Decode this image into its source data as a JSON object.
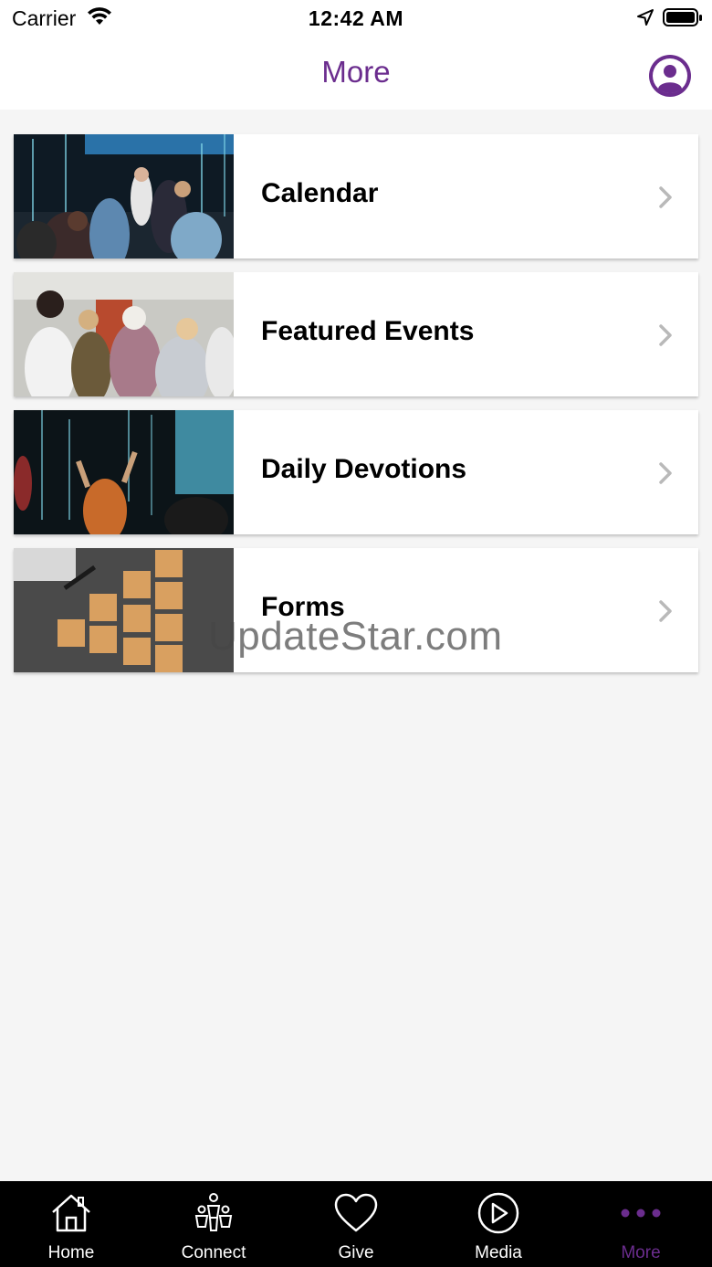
{
  "status_bar": {
    "carrier": "Carrier",
    "time": "12:42 AM"
  },
  "header": {
    "title": "More",
    "profile_icon": "person-icon"
  },
  "menu_items": [
    {
      "label": "Calendar",
      "thumbnail": "worship-stage-photo"
    },
    {
      "label": "Featured Events",
      "thumbnail": "group-gathering-photo"
    },
    {
      "label": "Daily Devotions",
      "thumbnail": "worship-hands-raised-photo"
    },
    {
      "label": "Forms",
      "thumbnail": "sticky-notes-desk-photo"
    }
  ],
  "watermark": "UpdateStar.com",
  "tabs": [
    {
      "label": "Home",
      "icon": "home-icon",
      "active": false
    },
    {
      "label": "Connect",
      "icon": "people-icon",
      "active": false
    },
    {
      "label": "Give",
      "icon": "heart-icon",
      "active": false
    },
    {
      "label": "Media",
      "icon": "play-circle-icon",
      "active": false
    },
    {
      "label": "More",
      "icon": "more-dots-icon",
      "active": true
    }
  ],
  "colors": {
    "accent": "#6b2d8e",
    "tab_bar_background": "#000000",
    "page_background": "#f5f5f5"
  }
}
